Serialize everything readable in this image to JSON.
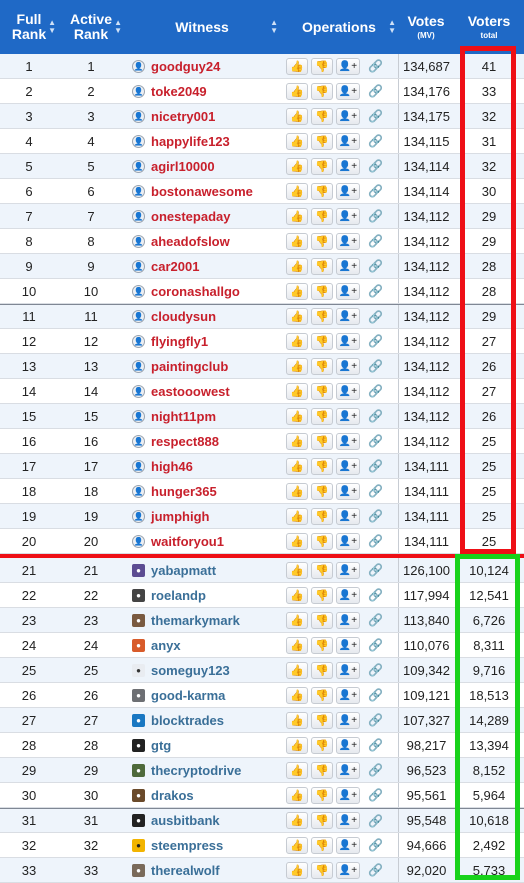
{
  "header": {
    "full_rank": "Full",
    "full_rank_2": "Rank",
    "active_rank": "Active",
    "active_rank_2": "Rank",
    "witness": "Witness",
    "operations": "Operations",
    "votes": "Votes",
    "votes_unit": "(MV)",
    "voters": "Voters",
    "voters_sub": "total"
  },
  "colors": {
    "header_bg": "#1f69c6",
    "highlight_red": "#ee0f16",
    "highlight_green": "#18d21b",
    "name_red": "#c8202c",
    "name_blue": "#3a6f98"
  },
  "icons": {
    "approve": "thumbs-up-icon",
    "unapprove": "thumbs-down-icon",
    "proxy": "add-user-icon",
    "link": "link-icon",
    "sort": "sort-arrows-icon"
  },
  "rows": [
    {
      "full_rank": "1",
      "active_rank": "1",
      "name": "goodguy24",
      "votes": "134,687",
      "voters": "41"
    },
    {
      "full_rank": "2",
      "active_rank": "2",
      "name": "toke2049",
      "votes": "134,176",
      "voters": "33"
    },
    {
      "full_rank": "3",
      "active_rank": "3",
      "name": "nicetry001",
      "votes": "134,175",
      "voters": "32"
    },
    {
      "full_rank": "4",
      "active_rank": "4",
      "name": "happylife123",
      "votes": "134,115",
      "voters": "31"
    },
    {
      "full_rank": "5",
      "active_rank": "5",
      "name": "agirl10000",
      "votes": "134,114",
      "voters": "32"
    },
    {
      "full_rank": "6",
      "active_rank": "6",
      "name": "bostonawesome",
      "votes": "134,114",
      "voters": "30"
    },
    {
      "full_rank": "7",
      "active_rank": "7",
      "name": "onestepaday",
      "votes": "134,112",
      "voters": "29"
    },
    {
      "full_rank": "8",
      "active_rank": "8",
      "name": "aheadofslow",
      "votes": "134,112",
      "voters": "29"
    },
    {
      "full_rank": "9",
      "active_rank": "9",
      "name": "car2001",
      "votes": "134,112",
      "voters": "28"
    },
    {
      "full_rank": "10",
      "active_rank": "10",
      "name": "coronashallgo",
      "votes": "134,112",
      "voters": "28"
    },
    {
      "full_rank": "11",
      "active_rank": "11",
      "name": "cloudysun",
      "votes": "134,112",
      "voters": "29"
    },
    {
      "full_rank": "12",
      "active_rank": "12",
      "name": "flyingfly1",
      "votes": "134,112",
      "voters": "27"
    },
    {
      "full_rank": "13",
      "active_rank": "13",
      "name": "paintingclub",
      "votes": "134,112",
      "voters": "26"
    },
    {
      "full_rank": "14",
      "active_rank": "14",
      "name": "eastooowest",
      "votes": "134,112",
      "voters": "27"
    },
    {
      "full_rank": "15",
      "active_rank": "15",
      "name": "night11pm",
      "votes": "134,112",
      "voters": "26"
    },
    {
      "full_rank": "16",
      "active_rank": "16",
      "name": "respect888",
      "votes": "134,112",
      "voters": "25"
    },
    {
      "full_rank": "17",
      "active_rank": "17",
      "name": "high46",
      "votes": "134,111",
      "voters": "25"
    },
    {
      "full_rank": "18",
      "active_rank": "18",
      "name": "hunger365",
      "votes": "134,111",
      "voters": "25"
    },
    {
      "full_rank": "19",
      "active_rank": "19",
      "name": "jumphigh",
      "votes": "134,111",
      "voters": "25"
    },
    {
      "full_rank": "20",
      "active_rank": "20",
      "name": "waitforyou1",
      "votes": "134,111",
      "voters": "25"
    },
    {
      "full_rank": "21",
      "active_rank": "21",
      "name": "yabapmatt",
      "votes": "126,100",
      "voters": "10,124"
    },
    {
      "full_rank": "22",
      "active_rank": "22",
      "name": "roelandp",
      "votes": "117,994",
      "voters": "12,541"
    },
    {
      "full_rank": "23",
      "active_rank": "23",
      "name": "themarkymark",
      "votes": "113,840",
      "voters": "6,726"
    },
    {
      "full_rank": "24",
      "active_rank": "24",
      "name": "anyx",
      "votes": "110,076",
      "voters": "8,311"
    },
    {
      "full_rank": "25",
      "active_rank": "25",
      "name": "someguy123",
      "votes": "109,342",
      "voters": "9,716"
    },
    {
      "full_rank": "26",
      "active_rank": "26",
      "name": "good-karma",
      "votes": "109,121",
      "voters": "18,513"
    },
    {
      "full_rank": "27",
      "active_rank": "27",
      "name": "blocktrades",
      "votes": "107,327",
      "voters": "14,289"
    },
    {
      "full_rank": "28",
      "active_rank": "28",
      "name": "gtg",
      "votes": "98,217",
      "voters": "13,394"
    },
    {
      "full_rank": "29",
      "active_rank": "29",
      "name": "thecryptodrive",
      "votes": "96,523",
      "voters": "8,152"
    },
    {
      "full_rank": "30",
      "active_rank": "30",
      "name": "drakos",
      "votes": "95,561",
      "voters": "5,964"
    },
    {
      "full_rank": "31",
      "active_rank": "31",
      "name": "ausbitbank",
      "votes": "95,548",
      "voters": "10,618"
    },
    {
      "full_rank": "32",
      "active_rank": "32",
      "name": "steempress",
      "votes": "94,666",
      "voters": "2,492"
    },
    {
      "full_rank": "33",
      "active_rank": "33",
      "name": "therealwolf",
      "votes": "92,020",
      "voters": "5,733"
    }
  ]
}
